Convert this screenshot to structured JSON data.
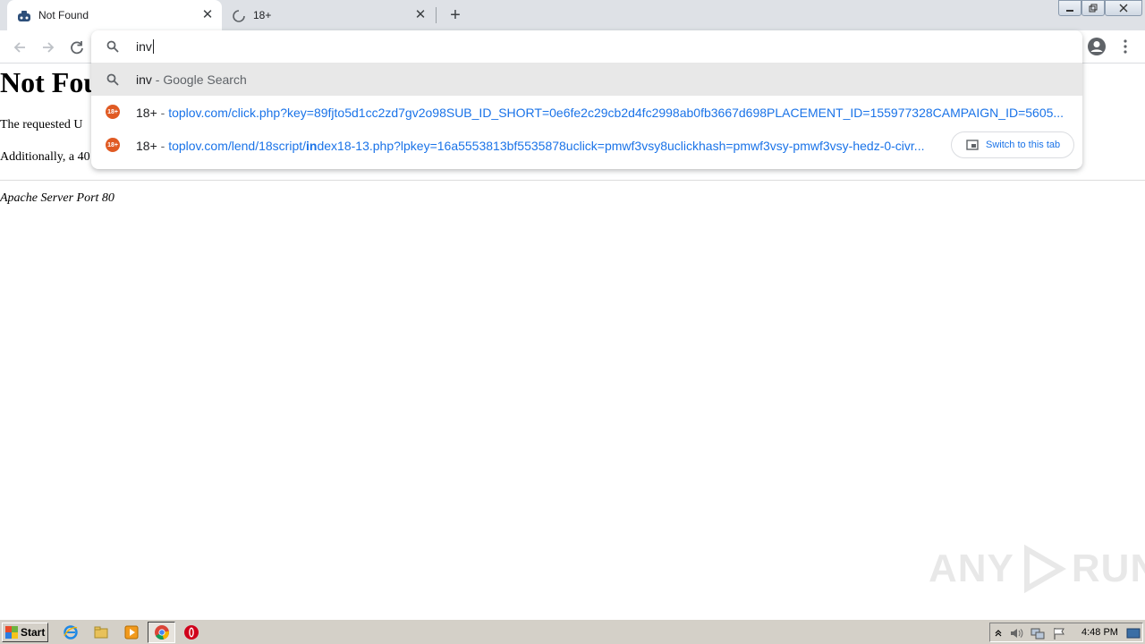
{
  "tabs": [
    {
      "title": "Not Found",
      "favicon": "apache-feather-icon",
      "active": true
    },
    {
      "title": "18+",
      "favicon": "loading-spinner-icon",
      "active": false
    }
  ],
  "omnibox": {
    "input": "inv",
    "suggestions": [
      {
        "match": "inv",
        "description": " - Google Search",
        "icon": "search-icon"
      },
      {
        "title": "18+",
        "sep": " - ",
        "url": "toplov.com/click.php?key=89fjto5d1cc2zd7gv2o98SUB_ID_SHORT=0e6fe2c29cb2d4fc2998ab0fb3667d698PLACEMENT_ID=155977328CAMPAIGN_ID=5605...",
        "icon": "18plus-icon"
      },
      {
        "title": "18+",
        "sep": " - ",
        "url_pre": "toplov.com/lend/18script/",
        "url_bold": "in",
        "url_post": "dex18-13.php?lpkey=16a5553813bf5535878uclick=pmwf3vsy8uclickhash=pmwf3vsy-pmwf3vsy-hedz-0-civr...",
        "icon": "18plus-icon",
        "switch_label": "Switch to this tab"
      }
    ]
  },
  "page": {
    "heading": "Not Fou",
    "line1": "The requested U",
    "line2": "Additionally, a 40",
    "footer": "Apache Server Port 80"
  },
  "watermark": {
    "left": "ANY",
    "right": "RUN"
  },
  "taskbar": {
    "start_label": "Start",
    "clock": "4:48 PM"
  },
  "colors": {
    "tabstrip": "#dee1e6",
    "link": "#1a73e8",
    "badge": "#e05a23",
    "taskbar": "#d4d0c8"
  }
}
